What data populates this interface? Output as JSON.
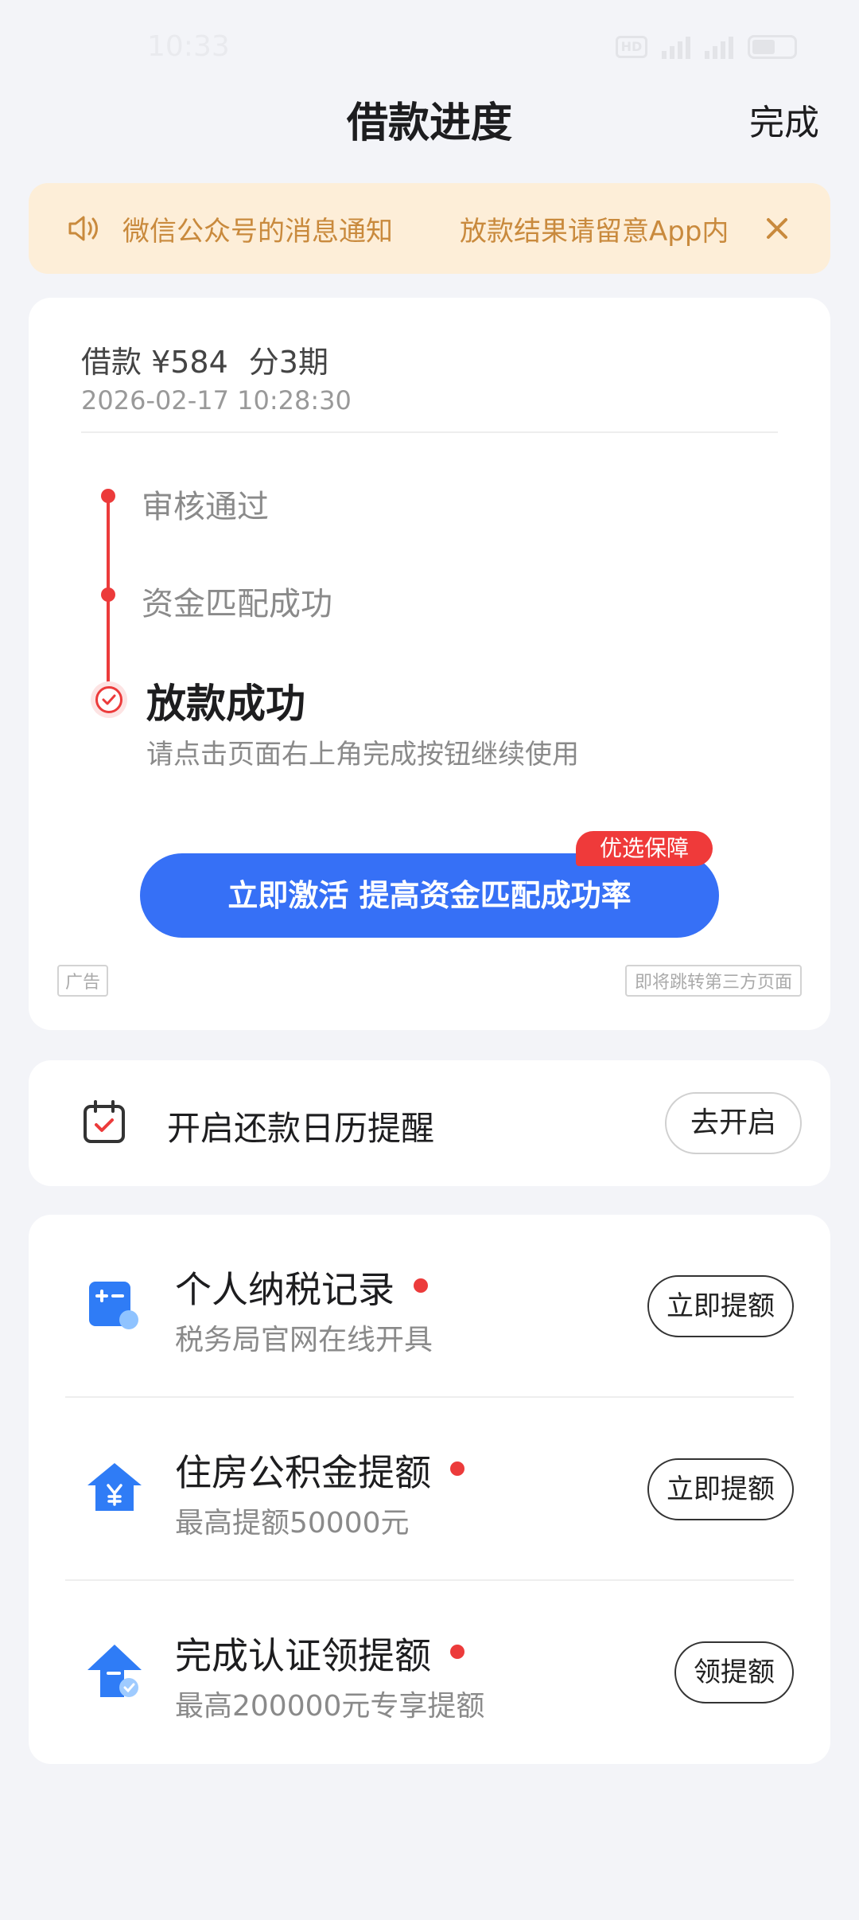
{
  "status_bar": {
    "time": "10:33",
    "hd": "HD",
    "battery_level": 0.55
  },
  "header": {
    "title": "借款进度",
    "done_label": "完成"
  },
  "notice": {
    "text1": "微信公众号的消息通知",
    "text2": "放款结果请留意App内",
    "icon": "speaker-icon",
    "close_icon": "close-icon",
    "color": "#c98a3d"
  },
  "progress": {
    "loan_amount": "借款 ¥584",
    "loan_term": "分3期",
    "loan_time": "2026-02-17 10:28:30",
    "steps": [
      {
        "label": "审核通过"
      },
      {
        "label": "资金匹配成功"
      }
    ],
    "final_step": "放款成功",
    "final_hint": "请点击页面右上角完成按钮继续使用",
    "activate_button": "立即激活 提高资金匹配成功率",
    "promo_badge": "优选保障",
    "ad_tag": "广告",
    "jump_tag": "即将跳转第三方页面",
    "accent": "#3670f6",
    "alert_color": "#ec3b3b"
  },
  "calendar": {
    "icon": "calendar-check-icon",
    "text": "开启还款日历提醒",
    "button": "去开启"
  },
  "services": [
    {
      "icon": "calculator-icon",
      "title": "个人纳税记录",
      "subtitle": "税务局官网在线开具",
      "button": "立即提额"
    },
    {
      "icon": "house-yuan-icon",
      "title": "住房公积金提额",
      "subtitle": "最高提额50000元",
      "button": "立即提额"
    },
    {
      "icon": "arrow-up-badge-icon",
      "title": "完成认证领提额",
      "subtitle": "最高200000元专享提额",
      "button": "领提额"
    }
  ]
}
